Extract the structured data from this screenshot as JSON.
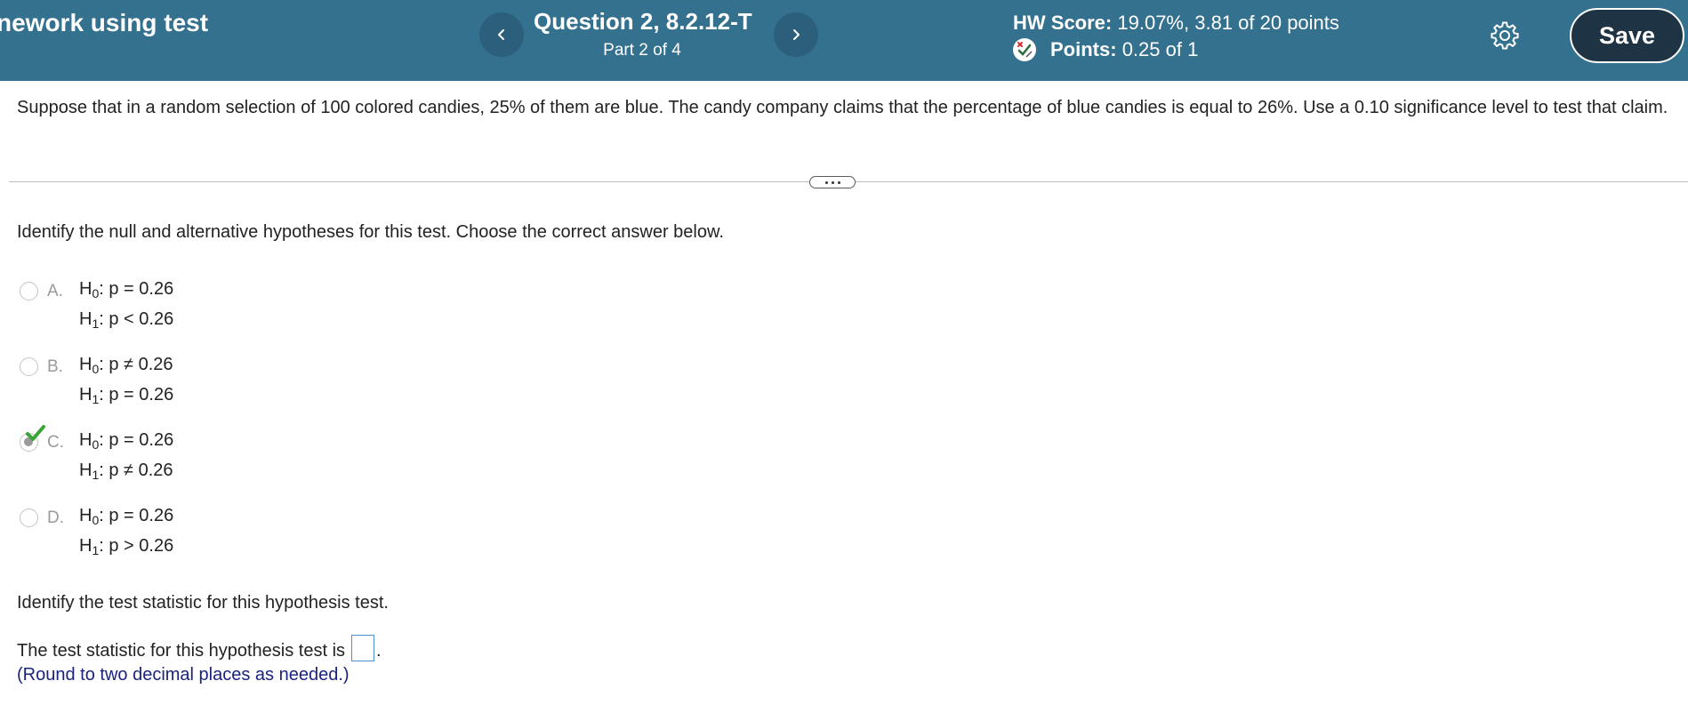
{
  "header": {
    "hw_title": "nework using test",
    "question_title": "Question 2, 8.2.12-T",
    "question_part": "Part 2 of 4",
    "hw_score_label": "HW Score:",
    "hw_score_value": "19.07%, 3.81 of 20 points",
    "points_label": "Points:",
    "points_value": "0.25 of 1",
    "save_label": "Save",
    "prev_icon": "chevron-left-icon",
    "next_icon": "chevron-right-icon",
    "settings_icon": "gear-icon",
    "points_icon": "partial-credit-icon",
    "colors": {
      "header_bg": "#34718f",
      "nav_bg": "#2b5f7b",
      "save_bg": "#1e3444"
    }
  },
  "problem": {
    "text": "Suppose that in a random selection of 100 colored candies, 25% of them are blue. The candy company claims that the percentage of blue candies is equal to 26%. Use a 0.10 significance level to test that claim."
  },
  "question": {
    "instruction": "Identify the null and alternative hypotheses for this test. Choose the correct answer below.",
    "options": [
      {
        "letter": "A.",
        "h0_label": "H",
        "h0_sub": "0",
        "h0_rel": ": p = 0.26",
        "h1_label": "H",
        "h1_sub": "1",
        "h1_rel": ": p < 0.26",
        "selected": false
      },
      {
        "letter": "B.",
        "h0_label": "H",
        "h0_sub": "0",
        "h0_rel": ": p ≠ 0.26",
        "h1_label": "H",
        "h1_sub": "1",
        "h1_rel": ": p = 0.26",
        "selected": false
      },
      {
        "letter": "C.",
        "h0_label": "H",
        "h0_sub": "0",
        "h0_rel": ": p = 0.26",
        "h1_label": "H",
        "h1_sub": "1",
        "h1_rel": ": p ≠ 0.26",
        "selected": true
      },
      {
        "letter": "D.",
        "h0_label": "H",
        "h0_sub": "0",
        "h0_rel": ": p = 0.26",
        "h1_label": "H",
        "h1_sub": "1",
        "h1_rel": ": p > 0.26",
        "selected": false
      }
    ],
    "correct_icon": "checkmark-icon",
    "correct_color": "#3aa335"
  },
  "test_statistic": {
    "prompt": "Identify the test statistic for this hypothesis test.",
    "line_text": "The test statistic for this hypothesis test is",
    "value": "",
    "suffix": ".",
    "round_note": "(Round to two decimal places as needed.)",
    "round_note_color": "#1a237e"
  }
}
